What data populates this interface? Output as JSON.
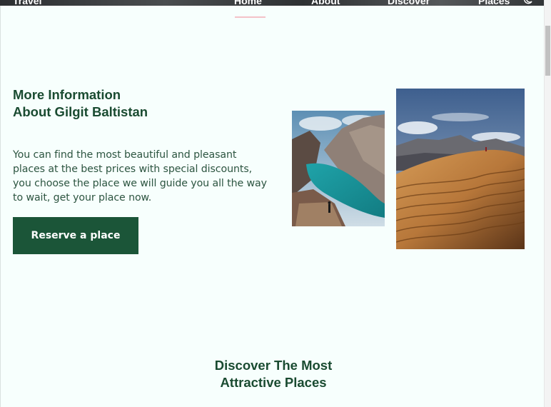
{
  "nav": {
    "logo": "Travel",
    "home": "Home",
    "about": "About",
    "discover": "Discover",
    "places": "Places",
    "theme_icon": "moon-icon"
  },
  "info": {
    "title_line1": "More Information",
    "title_line2": "About Gilgit Baltistan",
    "description": "You can find the most beautiful and pleasant places at the best prices with special discounts, you choose the place we will guide you all the way to wait, get your place now.",
    "button_label": "Reserve a place"
  },
  "images": {
    "lake": "mountain-lake-hiker-photo",
    "dunes": "desert-dunes-photo"
  },
  "section": {
    "title_line1": "Discover The Most",
    "title_line2": "Attractive Places"
  },
  "colors": {
    "primary": "#1b5538",
    "heading": "#1a4b31",
    "background": "#f7fffd",
    "active_underline": "#f4c2c8"
  }
}
